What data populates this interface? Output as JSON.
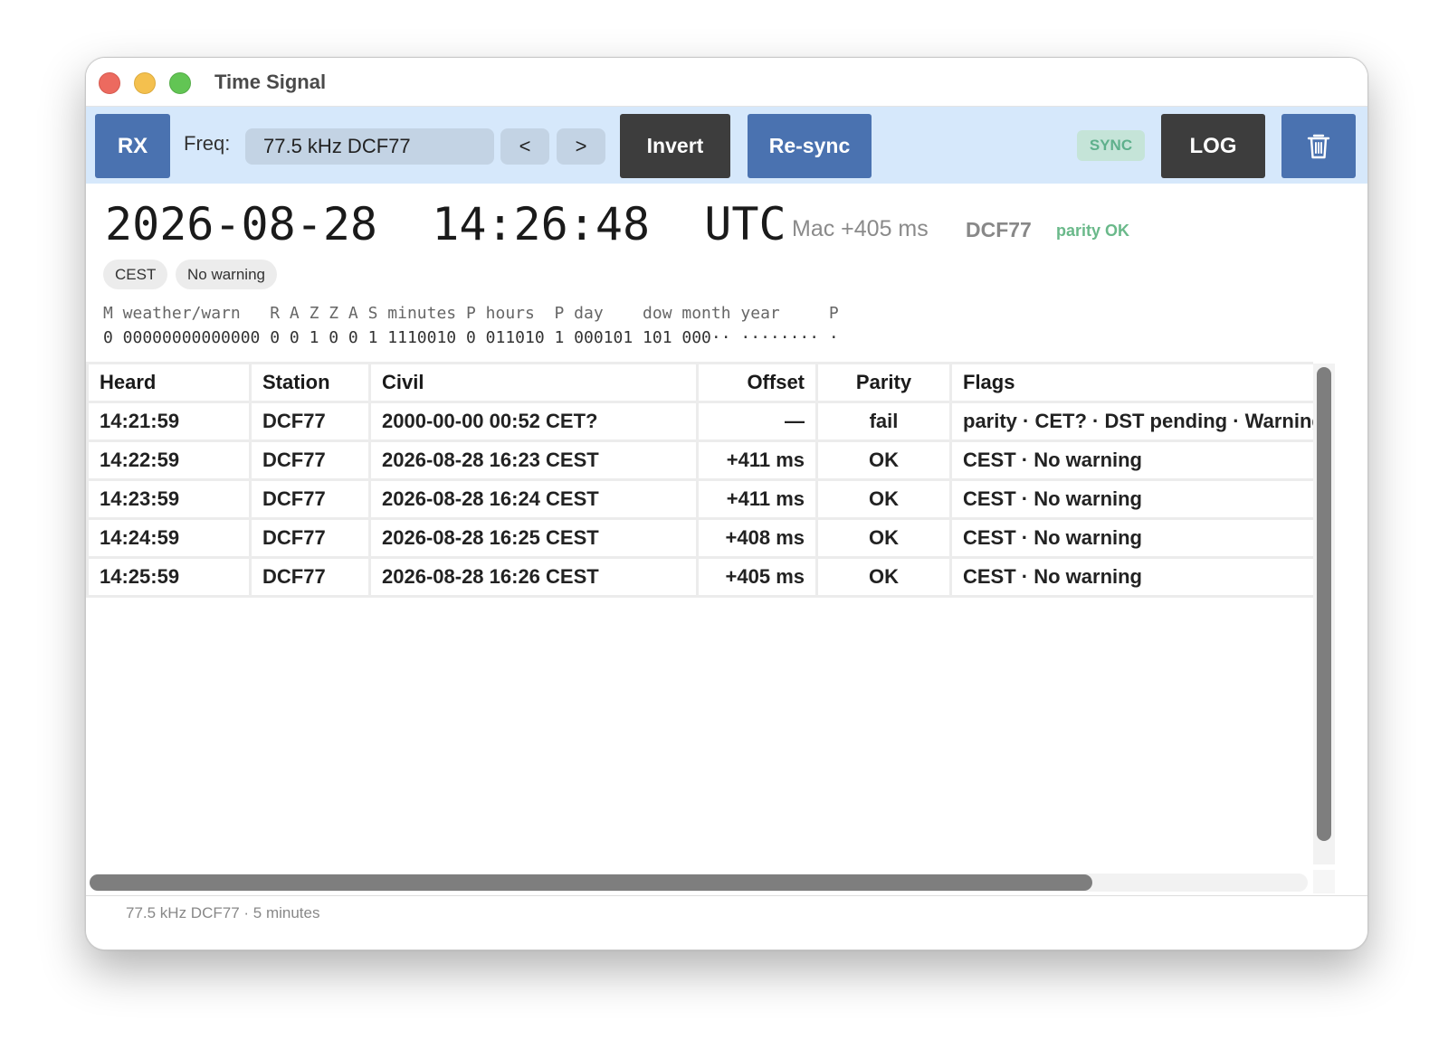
{
  "window": {
    "title": "Time Signal"
  },
  "toolbar": {
    "rx_label": "RX",
    "freq_label": "Freq:",
    "freq_value": "77.5 kHz DCF77",
    "prev_label": "<",
    "next_label": ">",
    "invert_label": "Invert",
    "resync_label": "Re-sync",
    "sync_badge": "SYNC",
    "log_label": "LOG",
    "trash_icon": "trash-icon"
  },
  "clock": {
    "date": "2026-08-28",
    "time": "14:26:48",
    "zone": "UTC",
    "mac_offset": "Mac +405 ms",
    "station": "DCF77",
    "parity": "parity OK"
  },
  "chips": {
    "tz": "CEST",
    "warning": "No warning"
  },
  "bits": {
    "header": "M weather/warn   R A Z Z A S minutes P hours  P day    dow month year     P",
    "row": "0 00000000000000 0 0 1 0 0 1 1110010 0 011010 1 000101 101 000·· ········ ·"
  },
  "table": {
    "headers": {
      "heard": "Heard",
      "station": "Station",
      "civil": "Civil",
      "offset": "Offset",
      "parity": "Parity",
      "flags": "Flags"
    },
    "rows": [
      {
        "heard": "14:21:59",
        "station": "DCF77",
        "civil": "2000-00-00 00:52 CET?",
        "offset": "—",
        "parity": "fail",
        "flags": "parity · CET? · DST pending · Warning"
      },
      {
        "heard": "14:22:59",
        "station": "DCF77",
        "civil": "2026-08-28 16:23 CEST",
        "offset": "+411 ms",
        "parity": "OK",
        "flags": "CEST · No warning"
      },
      {
        "heard": "14:23:59",
        "station": "DCF77",
        "civil": "2026-08-28 16:24 CEST",
        "offset": "+411 ms",
        "parity": "OK",
        "flags": "CEST · No warning"
      },
      {
        "heard": "14:24:59",
        "station": "DCF77",
        "civil": "2026-08-28 16:25 CEST",
        "offset": "+408 ms",
        "parity": "OK",
        "flags": "CEST · No warning"
      },
      {
        "heard": "14:25:59",
        "station": "DCF77",
        "civil": "2026-08-28 16:26 CEST",
        "offset": "+405 ms",
        "parity": "OK",
        "flags": "CEST · No warning"
      }
    ]
  },
  "status": {
    "text": "77.5 kHz DCF77 · 5 minutes"
  },
  "colors": {
    "accent_blue": "#4a72b0",
    "dark_button": "#3d3d3d",
    "toolbar_bg": "#d6e8fb",
    "sync_green": "#5eb08c"
  }
}
